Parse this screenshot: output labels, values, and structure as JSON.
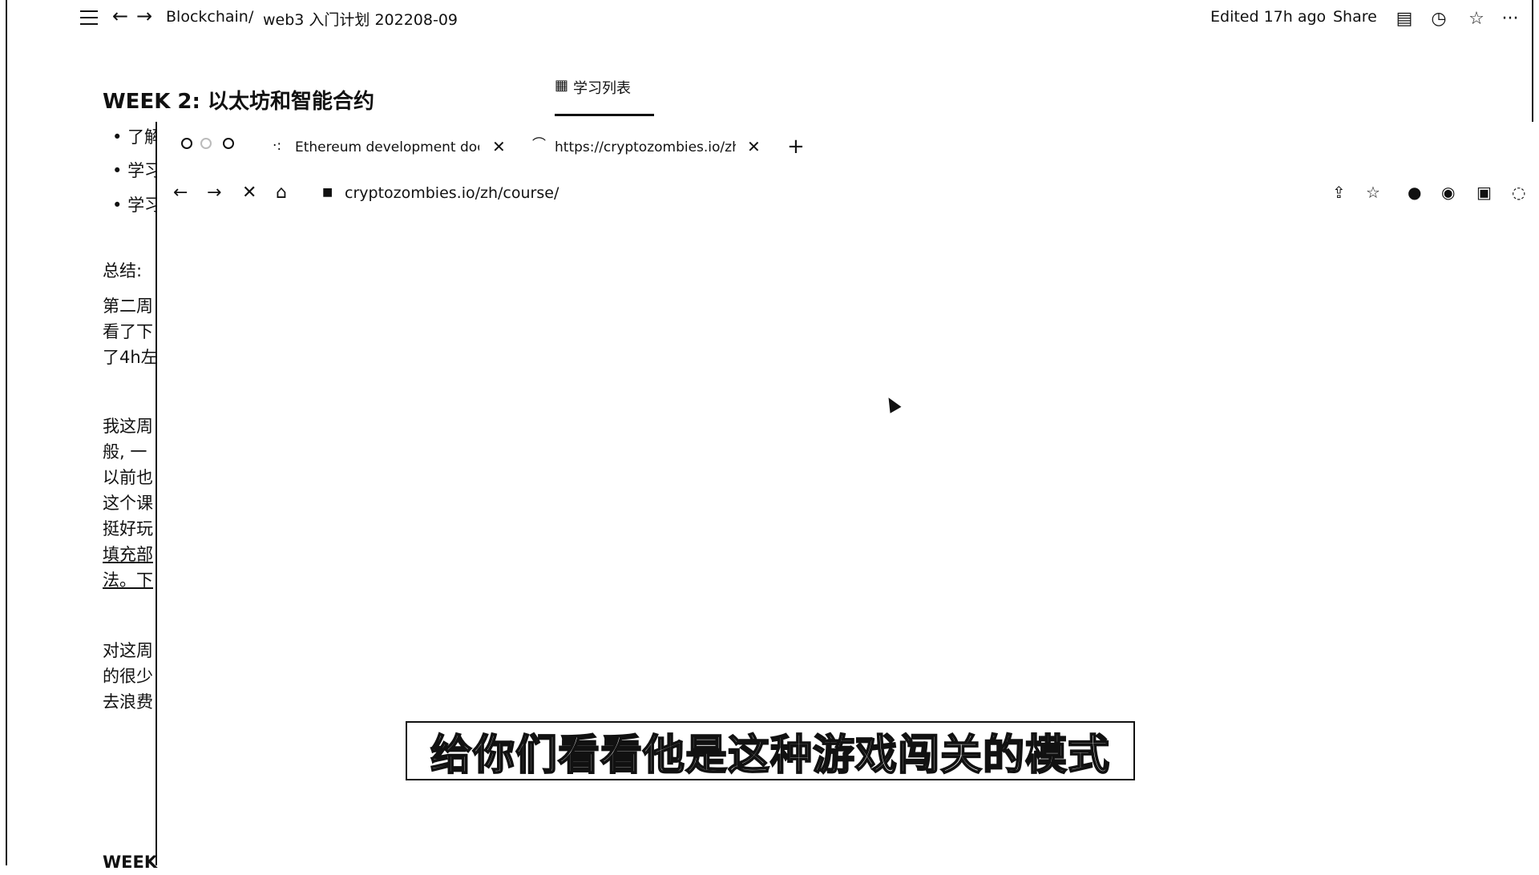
{
  "topbar": {
    "breadcrumb_root": "Blockchain",
    "breadcrumb_sep": "/",
    "breadcrumb_page": "web3 入门计划 202208-09",
    "edited": "Edited 17h ago",
    "share": "Share"
  },
  "doc": {
    "title": "WEEK 2: 以太坊和智能合约",
    "view_tab": "学习列表",
    "bullets": [
      "了解",
      "学习",
      "学习"
    ],
    "summary_label": "总结:",
    "para1": [
      "第二周",
      "看了下",
      "了4h左"
    ],
    "para2": [
      "我这周",
      "般, 一",
      "以前也",
      "这个课",
      "挺好玩",
      "填充部",
      "法。下"
    ],
    "para3": [
      "对这周",
      "的很少",
      "去浪费"
    ],
    "next_heading": "WEEK"
  },
  "browser": {
    "tabs": [
      {
        "label": "Ethereum development docum"
      },
      {
        "label": "https://cryptozombies.io/zh/cc"
      }
    ],
    "url": "cryptozombies.io/zh/course/"
  },
  "subtitle": "给你们看看他是这种游戏闯关的模式",
  "icons": [
    "menu-icon",
    "back-icon",
    "forward-icon",
    "comment-icon",
    "history-icon",
    "star-icon",
    "more-icon",
    "close-icon",
    "plus-icon",
    "home-icon",
    "lock-icon",
    "share-icon",
    "bookmark-icon",
    "extension-icon"
  ]
}
